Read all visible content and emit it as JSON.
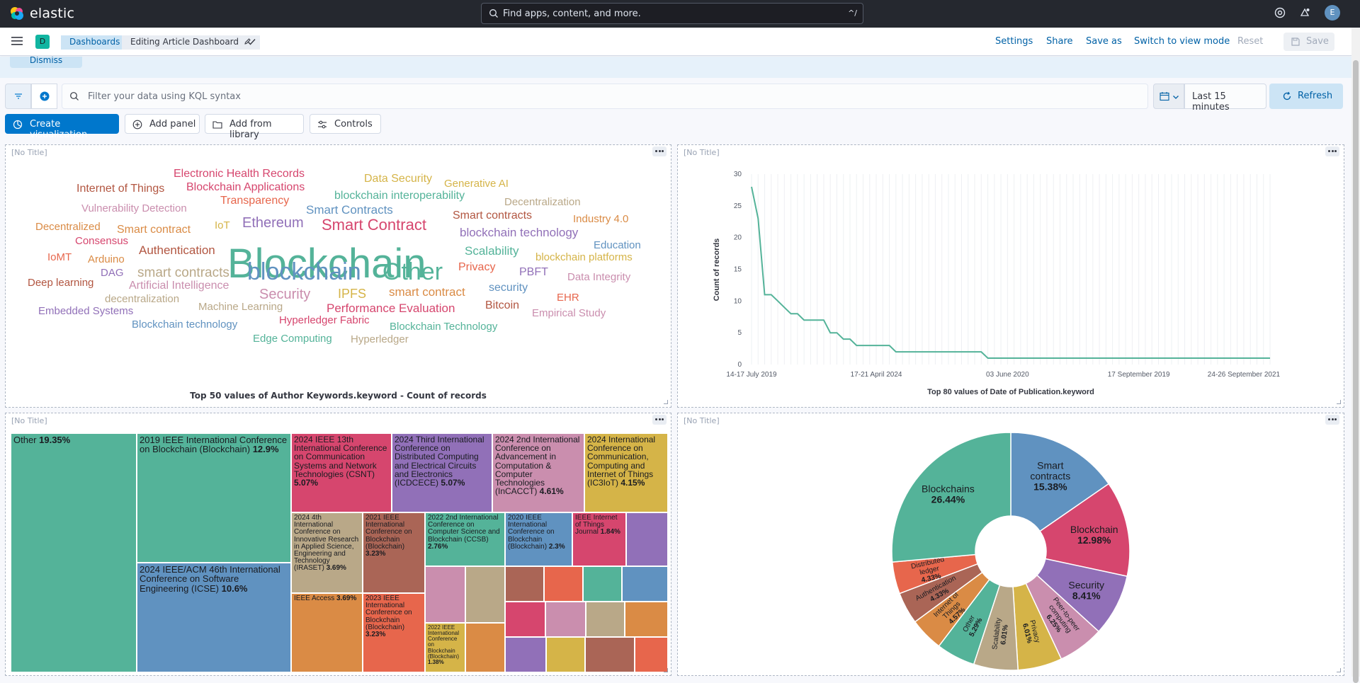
{
  "header": {
    "logo_text": "elastic",
    "search_placeholder": "Find apps, content, and more.",
    "search_shortcut": "^/",
    "avatar_initial": "E"
  },
  "nav": {
    "space_initial": "D",
    "breadcrumbs": [
      "Dashboards",
      "Editing Article Dashboard"
    ],
    "settings": "Settings",
    "share": "Share",
    "save_as": "Save as",
    "switch_view": "Switch to view mode",
    "reset": "Reset",
    "save": "Save"
  },
  "callout": {
    "dismiss": "Dismiss"
  },
  "query": {
    "placeholder": "Filter your data using KQL syntax",
    "date_range": "Last 15 minutes",
    "refresh": "Refresh"
  },
  "toolbar": {
    "create_visualization": "Create visualization",
    "add_panel": "Add panel",
    "add_from_library": "Add from library",
    "controls": "Controls"
  },
  "panels": {
    "untitled": "[No Title]"
  },
  "wordcloud": {
    "caption": "Top 50 values of Author Keywords.keyword - Count of records",
    "words": [
      {
        "t": "Electronic Health Records",
        "c": "#d6466e"
      },
      {
        "t": "Data Security",
        "c": "#d5b448"
      },
      {
        "t": "Generative AI",
        "c": "#d5b448"
      },
      {
        "t": "Internet of Things",
        "c": "#b25641"
      },
      {
        "t": "Blockchain Applications",
        "c": "#d6466e"
      },
      {
        "t": "blockchain interoperability",
        "c": "#54b399"
      },
      {
        "t": "Transparency",
        "c": "#e7664c"
      },
      {
        "t": "Decentralization",
        "c": "#b9a888"
      },
      {
        "t": "Vulnerability Detection",
        "c": "#ca8eae"
      },
      {
        "t": "Smart Contracts",
        "c": "#6092c0"
      },
      {
        "t": "Ethereum",
        "c": "#9170b8"
      },
      {
        "t": "Smart Contract",
        "c": "#d6466e"
      },
      {
        "t": "Smart contracts",
        "c": "#b25641"
      },
      {
        "t": "Industry 4.0",
        "c": "#da8b45"
      },
      {
        "t": "Decentralized",
        "c": "#da8b45"
      },
      {
        "t": "Smart contract",
        "c": "#da8b45"
      },
      {
        "t": "IoT",
        "c": "#d5b448"
      },
      {
        "t": "Blockchain",
        "c": "#54b399"
      },
      {
        "t": "blockchain technology",
        "c": "#9170b8"
      },
      {
        "t": "Consensus",
        "c": "#d6466e"
      },
      {
        "t": "Authentication",
        "c": "#b25641"
      },
      {
        "t": "Scalability",
        "c": "#54b399"
      },
      {
        "t": "Education",
        "c": "#6092c0"
      },
      {
        "t": "IoMT",
        "c": "#e7664c"
      },
      {
        "t": "Arduino",
        "c": "#da8b45"
      },
      {
        "t": "blockchain platforms",
        "c": "#d5b448"
      },
      {
        "t": "smart contracts",
        "c": "#b9a888"
      },
      {
        "t": "Privacy",
        "c": "#e7664c"
      },
      {
        "t": "PBFT",
        "c": "#9170b8"
      },
      {
        "t": "DAG",
        "c": "#9170b8"
      },
      {
        "t": "blockchain",
        "c": "#6092c0"
      },
      {
        "t": "Other",
        "c": "#54b399"
      },
      {
        "t": "Data Integrity",
        "c": "#ca8eae"
      },
      {
        "t": "Deep learning",
        "c": "#b25641"
      },
      {
        "t": "Artificial Intelligence",
        "c": "#ca8eae"
      },
      {
        "t": "security",
        "c": "#6092c0"
      },
      {
        "t": "Security",
        "c": "#ca8eae"
      },
      {
        "t": "IPFS",
        "c": "#d5b448"
      },
      {
        "t": "smart contract",
        "c": "#da8b45"
      },
      {
        "t": "EHR",
        "c": "#e7664c"
      },
      {
        "t": "decentralization",
        "c": "#b9a888"
      },
      {
        "t": "Machine Learning",
        "c": "#b9a888"
      },
      {
        "t": "Performance Evaluation",
        "c": "#d6466e"
      },
      {
        "t": "Bitcoin",
        "c": "#b25641"
      },
      {
        "t": "Embedded Systems",
        "c": "#9170b8"
      },
      {
        "t": "Empirical Study",
        "c": "#ca8eae"
      },
      {
        "t": "Hyperledger Fabric",
        "c": "#d6466e"
      },
      {
        "t": "Blockchain technology",
        "c": "#6092c0"
      },
      {
        "t": "Blockchain Technology",
        "c": "#54b399"
      },
      {
        "t": "Edge Computing",
        "c": "#54b399"
      },
      {
        "t": "Hyperledger",
        "c": "#b9a888"
      }
    ]
  },
  "chart_data": [
    {
      "type": "line",
      "title": "Top 80 values of Date of Publication.keyword",
      "xlabel": "Top 80 values of Date of Publication.keyword",
      "ylabel": "Count of records",
      "ylim": [
        0,
        30
      ],
      "yticks": [
        0,
        5,
        10,
        15,
        20,
        25,
        30
      ],
      "xticks": [
        {
          "i": 0,
          "label": "14-17 July 2019"
        },
        {
          "i": 19,
          "label": "17-21 April 2024"
        },
        {
          "i": 39,
          "label": "03 June 2020"
        },
        {
          "i": 59,
          "label": "17 September 2019"
        },
        {
          "i": 75,
          "label": "24-26 September 2021"
        }
      ],
      "grid": true,
      "color": "#54b399",
      "values": [
        28,
        23,
        11,
        11,
        10,
        9,
        8,
        8,
        7,
        7,
        7,
        7,
        5,
        5,
        4,
        4,
        3,
        3,
        3,
        3,
        3,
        3,
        2,
        2,
        2,
        2,
        2,
        2,
        2,
        2,
        2,
        2,
        2,
        2,
        2,
        2,
        1,
        1,
        1,
        1,
        1,
        1,
        1,
        1,
        1,
        1,
        1,
        1,
        1,
        1,
        1,
        1,
        1,
        1,
        1,
        1,
        1,
        1,
        1,
        1,
        1,
        1,
        1,
        1,
        1,
        1,
        1,
        1,
        1,
        1,
        1,
        1,
        1,
        1,
        1,
        1,
        1,
        1,
        1,
        1
      ]
    },
    {
      "type": "pie",
      "donut": true,
      "slices": [
        {
          "label": "Smart contracts",
          "value": 15.38,
          "color": "#6092c0"
        },
        {
          "label": "Blockchain",
          "value": 12.98,
          "color": "#d6466e"
        },
        {
          "label": "Security",
          "value": 8.41,
          "color": "#9170b8"
        },
        {
          "label": "Peer-to-peer computing",
          "value": 6.25,
          "color": "#ca8eae"
        },
        {
          "label": "Privacy",
          "value": 6.01,
          "color": "#d5b448"
        },
        {
          "label": "Scalability",
          "value": 6.01,
          "color": "#b9a888"
        },
        {
          "label": "Other",
          "value": 5.29,
          "color": "#54b399"
        },
        {
          "label": "Internet of Things",
          "value": 4.57,
          "color": "#da8b45"
        },
        {
          "label": "Authentication",
          "value": 4.33,
          "color": "#aa6556"
        },
        {
          "label": "Distributed ledger",
          "value": 4.33,
          "color": "#e7664c"
        },
        {
          "label": "Blockchains",
          "value": 26.44,
          "color": "#54b399"
        }
      ]
    },
    {
      "type": "treemap",
      "cells": [
        {
          "label": "Other",
          "pct": "19.35%",
          "color": "#54b399"
        },
        {
          "label": "2019 IEEE International Conference on Blockchain (Blockchain)",
          "pct": "12.9%",
          "color": "#54b399"
        },
        {
          "label": "2024 IEEE/ACM 46th International Conference on Software Engineering (ICSE)",
          "pct": "10.6%",
          "color": "#6092c0"
        },
        {
          "label": "2024 IEEE 13th International Conference on Communication Systems and Network Technologies (CSNT)",
          "pct": "5.07%",
          "color": "#d6466e"
        },
        {
          "label": "2024 Third International Conference on Distributed Computing and Electrical Circuits and Electronics (ICDCECE)",
          "pct": "5.07%",
          "color": "#9170b8"
        },
        {
          "label": "2024 2nd International Conference on Advancement in Computation & Computer Technologies (InCACCT)",
          "pct": "4.61%",
          "color": "#ca8eae"
        },
        {
          "label": "2024 International Conference on Communication, Computing and Internet of Things (IC3IoT)",
          "pct": "4.15%",
          "color": "#d5b448"
        },
        {
          "label": "2024 4th International Conference on Innovative Research in Applied Science, Engineering and Technology (IRASET)",
          "pct": "3.69%",
          "color": "#b9a888"
        },
        {
          "label": "2021 IEEE International Conference on Blockchain (Blockchain)",
          "pct": "3.23%",
          "color": "#aa6556"
        },
        {
          "label": "2022 2nd International Conference on Computer Science and Blockchain (CCSB)",
          "pct": "2.76%",
          "color": "#54b399"
        },
        {
          "label": "2020 IEEE International Conference on Blockchain (Blockchain)",
          "pct": "2.3%",
          "color": "#6092c0"
        },
        {
          "label": "IEEE Internet of Things Journal",
          "pct": "1.84%",
          "color": "#d6466e"
        },
        {
          "label": "IEEE Access",
          "pct": "3.69%",
          "color": "#da8b45"
        },
        {
          "label": "2023 IEEE International Conference on Blockchain (Blockchain)",
          "pct": "3.23%",
          "color": "#e7664c"
        },
        {
          "label": "2022 IEEE International Conference on Blockchain (Blockchain)",
          "pct": "1.38%",
          "color": "#d5b448"
        }
      ]
    }
  ]
}
